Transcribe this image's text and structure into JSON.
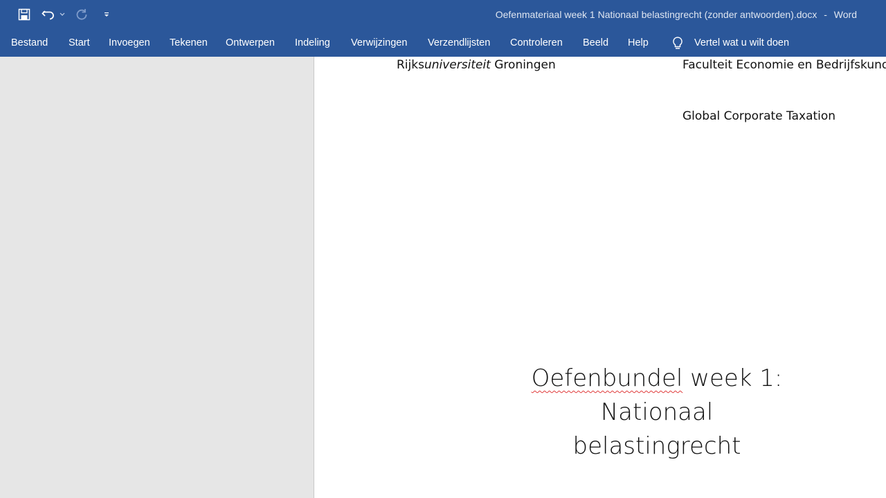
{
  "window": {
    "document_title": "Oefenmateriaal week 1 Nationaal belastingrecht (zonder antwoorden).docx",
    "separator": "-",
    "app_name": "Word"
  },
  "quick_access": {
    "icons": [
      "save-icon",
      "undo-icon",
      "undo-dropdown-icon",
      "redo-icon",
      "customize-qat-icon"
    ]
  },
  "ribbon": {
    "tabs": [
      {
        "label": "Bestand"
      },
      {
        "label": "Start"
      },
      {
        "label": "Invoegen"
      },
      {
        "label": "Tekenen"
      },
      {
        "label": "Ontwerpen"
      },
      {
        "label": "Indeling"
      },
      {
        "label": "Verwijzingen"
      },
      {
        "label": "Verzendlijsten"
      },
      {
        "label": "Controleren"
      },
      {
        "label": "Beeld"
      },
      {
        "label": "Help"
      }
    ],
    "tell_me": "Vertel wat u wilt doen"
  },
  "document": {
    "university_prefix": "Rijks",
    "university_italic": "universiteit",
    "university_suffix": " Groningen",
    "faculty": "Faculteit Economie en Bedrijfskunde",
    "course": "Global Corporate Taxation",
    "title_word1": "Oefenbundel",
    "title_rest_line1": " week 1:",
    "title_line2": "Nationaal belastingrecht"
  },
  "colors": {
    "ribbon": "#2b579a",
    "workspace": "#e6e6e6",
    "page": "#ffffff",
    "spell_underline": "#e03a3a"
  }
}
